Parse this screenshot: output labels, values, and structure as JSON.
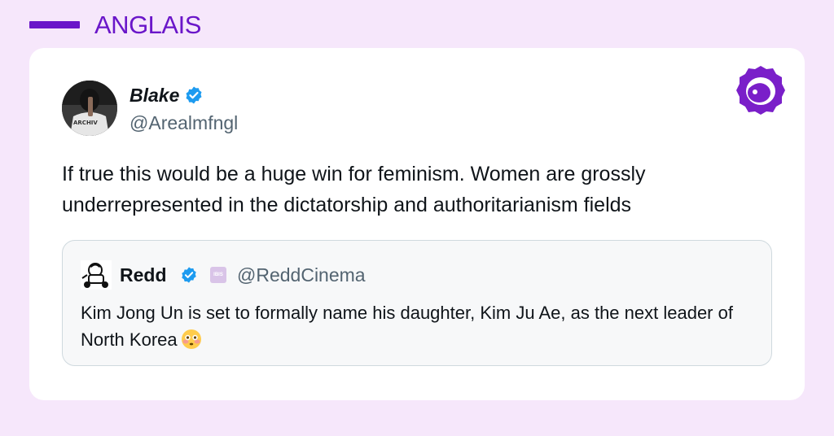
{
  "header": {
    "language_label": "ANGLAIS",
    "accent_color": "#6a16c9"
  },
  "tweet": {
    "author_name": "Blake",
    "author_handle": "@Arealmfngl",
    "avatar_text": "ARCHIV",
    "verified_icon": "verified-badge-icon",
    "text": "If true this would be a huge win for feminism. Women are grossly underrepresented in the dictatorship and authoritarianism fields"
  },
  "quoted_tweet": {
    "author_name": "Redd",
    "author_handle": "@ReddCinema",
    "badge_text": "IBIS",
    "text": "Kim Jong Un is set to formally name his daughter, Kim Ju Ae, as the next leader of North Korea",
    "emoji_icon": "flushed-face-icon"
  },
  "brand": {
    "logo_icon": "brand-logo-icon"
  }
}
